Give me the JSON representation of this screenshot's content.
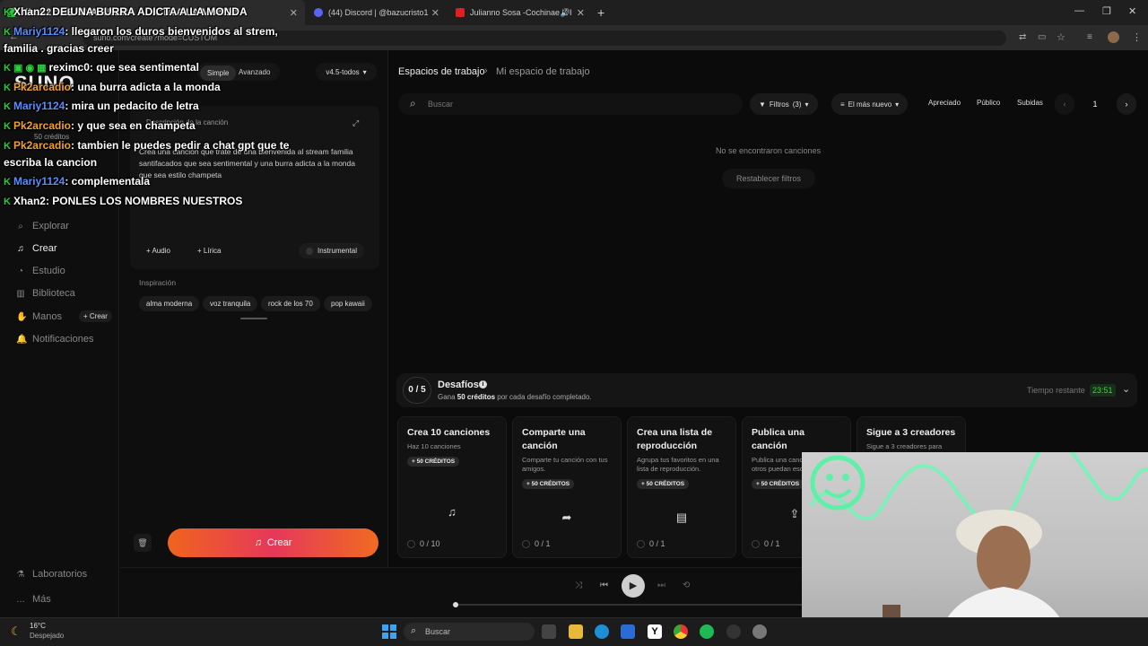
{
  "browser": {
    "tabs": [
      {
        "title": "Xhan2 : DE UNA BURRA ADICTA A LA MONDA",
        "active": true
      },
      {
        "title": "(44) Discord | @bazucristo1"
      },
      {
        "title": "Julianno Sosa -Cochinae X I"
      }
    ],
    "url": "suno.com/create?mode=CUSTOM"
  },
  "sidebar": {
    "logo": "SUNO",
    "credits": "50 créditos",
    "items": [
      {
        "label": "Explorar",
        "icon": "search-icon"
      },
      {
        "label": "Crear",
        "icon": "music-note-icon"
      },
      {
        "label": "Estudio",
        "icon": "studio-icon"
      },
      {
        "label": "Biblioteca",
        "icon": "library-icon"
      },
      {
        "label": "Manos",
        "icon": "hands-icon"
      },
      {
        "label": "Notificaciones",
        "icon": "bell-icon"
      }
    ],
    "manos_crear": "+ Crear",
    "bottom": [
      {
        "label": "Laboratorios",
        "icon": "flask-icon"
      },
      {
        "label": "Más",
        "icon": "more-icon"
      }
    ]
  },
  "create_panel": {
    "mode_simple": "Simple",
    "mode_avanzado": "Avanzado",
    "version": "v4.5-todos",
    "desc_label": "Descripción de la canción",
    "desc_text": "Crea una canción que trate de una bienvenida al stream familia santifacados que sea sentimental y una burra adicta a la monda que sea estilo champeta",
    "audio_btn": "Audio",
    "lirica_btn": "Lírica",
    "instrumental": "Instrumental",
    "inspiracion_label": "Inspiración",
    "inspiracion": [
      "alma moderna",
      "voz tranquila",
      "rock de los 70",
      "pop kawaii"
    ],
    "crear_btn": "Crear"
  },
  "main": {
    "breadcrumb_root": "Espacios de trabajo",
    "breadcrumb_current": "Mi espacio de trabajo",
    "search_placeholder": "Buscar",
    "filtros": "Filtros",
    "filtros_count": "(3)",
    "sort": "El más nuevo",
    "btn_apreciado": "Apreciado",
    "btn_publico": "Público",
    "btn_subidas": "Subidas",
    "page": "1",
    "empty": "No se encontraron canciones",
    "reset": "Restablecer filtros"
  },
  "challenges": {
    "progress": "0 / 5",
    "title": "Desafíos",
    "subtitle_pre": "Gana ",
    "subtitle_bold": "50 créditos",
    "subtitle_post": " por cada desafío completado.",
    "time_label": "Tiempo restante",
    "time_value": "23:51",
    "cards": [
      {
        "title": "Crea 10 canciones",
        "sub": "Haz 10 canciones",
        "badge": "+ 50 CRÉDITOS",
        "icon": "music-note-icon",
        "progress": "0 / 10"
      },
      {
        "title": "Comparte una canción",
        "sub": "Comparte tu canción con tus amigos.",
        "badge": "+ 50 CRÉDITOS",
        "icon": "share-icon",
        "progress": "0 / 1"
      },
      {
        "title": "Crea una lista de reproducción",
        "sub": "Agrupa tus favoritos en una lista de reproducción.",
        "badge": "+ 50 CRÉDITOS",
        "icon": "playlist-icon",
        "progress": "0 / 1"
      },
      {
        "title": "Publica una canción",
        "sub": "Publica una canción para que otros puedan escucharla.",
        "badge": "+ 50 CRÉDITOS",
        "icon": "upload-icon",
        "progress": "0 / 1"
      },
      {
        "title": "Sigue a 3 creadores",
        "sub": "Sigue a 3 creadores para",
        "badge": "",
        "icon": "",
        "progress": ""
      }
    ]
  },
  "chat": [
    {
      "user": "Xhan2",
      "msg": ": DE UNA BURRA ADICTA A LA MONDA",
      "color": "#ffffff"
    },
    {
      "user": "Mariy1124",
      "msg": ": llegaron los duros bienvenidos al strem,",
      "color": "#5b8cff"
    },
    {
      "user": "",
      "msg": "familia . gracias creer",
      "color": "#ffffff"
    },
    {
      "user": "reximc0",
      "msg": ": que sea sentimental",
      "color": "#ffffff"
    },
    {
      "user": "Pk2arcadio",
      "msg": ": una burra adicta a la monda",
      "color": "#f0a030"
    },
    {
      "user": "Mariy1124",
      "msg": ": mira un pedacito de letra",
      "color": "#5b8cff"
    },
    {
      "user": "Pk2arcadio",
      "msg": ": y que sea en champeta",
      "color": "#f0a030"
    },
    {
      "user": "Pk2arcadio",
      "msg": ": tambien le puedes pedir a chat gpt que te",
      "color": "#f0a030"
    },
    {
      "user": "",
      "msg": "escriba la cancion",
      "color": "#ffffff"
    },
    {
      "user": "Mariy1124",
      "msg": ": complementala",
      "color": "#5b8cff"
    },
    {
      "user": "Xhan2",
      "msg": ": PONLES LOS NOMBRES NUESTROS",
      "color": "#ffffff"
    }
  ],
  "taskbar": {
    "weather_temp": "16°C",
    "weather_desc": "Despejado",
    "search": "Buscar"
  }
}
